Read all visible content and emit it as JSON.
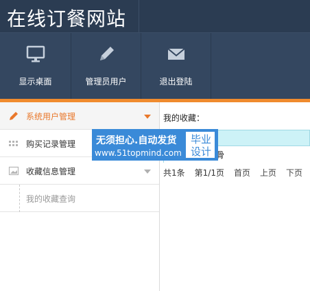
{
  "header": {
    "title": "在线订餐网站"
  },
  "toolbar": {
    "items": [
      {
        "label": "显示桌面",
        "icon": "monitor-icon"
      },
      {
        "label": "管理员用户",
        "icon": "pencil-icon"
      },
      {
        "label": "退出登陆",
        "icon": "envelope-icon"
      }
    ]
  },
  "sidebar": {
    "items": [
      {
        "label": "系统用户管理",
        "icon": "pencil-icon",
        "active": true
      },
      {
        "label": "购买记录管理",
        "icon": "grid-icon",
        "active": false
      },
      {
        "label": "收藏信息管理",
        "icon": "picture-icon",
        "active": false
      }
    ],
    "sub_item": {
      "label": "我的收藏查询"
    }
  },
  "main": {
    "fav_label": "我的收藏：",
    "fav_item": "骨",
    "pager": {
      "total": "共1条",
      "page": "第1/1页",
      "first": "首页",
      "prev": "上页",
      "next": "下页"
    }
  },
  "watermark": {
    "line1": "无须担心.自动发货",
    "line2": "www.51topmind.com",
    "box": "毕业设计"
  },
  "colors": {
    "header_bg": "#2b3c52",
    "toolbar_bg": "#344760",
    "accent": "#f08b2e",
    "active_text": "#e9782b",
    "watermark_bg": "#3a8ad8",
    "row_highlight": "#cdf2f7"
  }
}
